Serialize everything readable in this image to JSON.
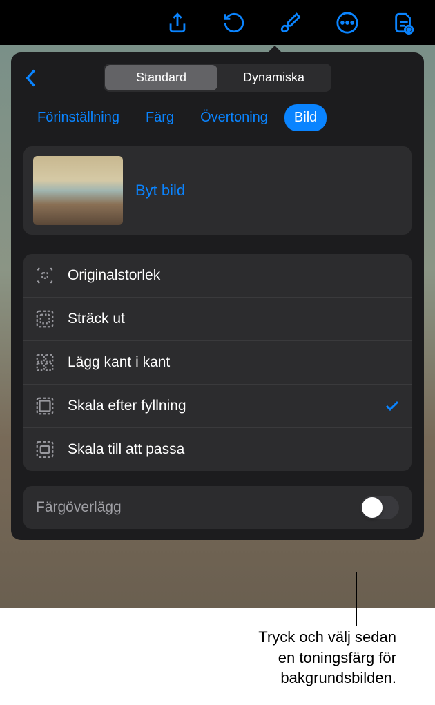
{
  "toolbar": {
    "icons": [
      "share",
      "undo",
      "brush",
      "more",
      "doc"
    ]
  },
  "segmented": {
    "options": [
      "Standard",
      "Dynamiska"
    ],
    "active": 0
  },
  "tabs": {
    "items": [
      "Förinställning",
      "Färg",
      "Övertoning",
      "Bild"
    ],
    "active": 3
  },
  "image_section": {
    "change_label": "Byt bild"
  },
  "scale_options": {
    "items": [
      {
        "label": "Originalstorlek",
        "selected": false
      },
      {
        "label": "Sträck ut",
        "selected": false
      },
      {
        "label": "Lägg kant i kant",
        "selected": false
      },
      {
        "label": "Skala efter fyllning",
        "selected": true
      },
      {
        "label": "Skala till att passa",
        "selected": false
      }
    ]
  },
  "overlay": {
    "label": "Färgöverlägg",
    "enabled": false
  },
  "callout": {
    "line1": "Tryck och välj sedan",
    "line2": "en toningsfärg för",
    "line3": "bakgrundsbilden."
  }
}
